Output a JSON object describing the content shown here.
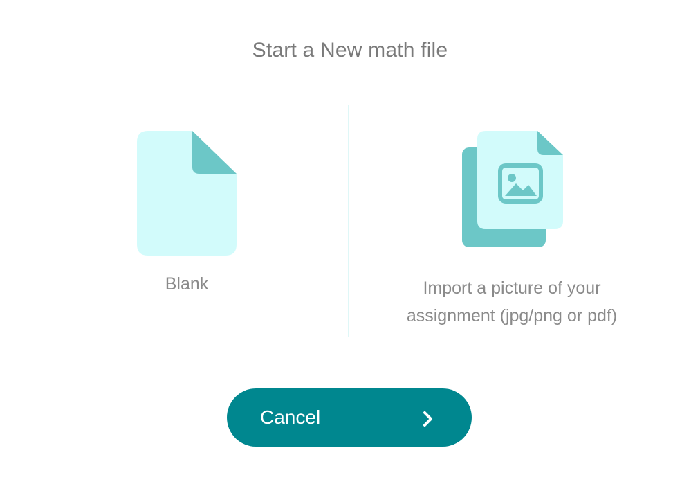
{
  "dialog": {
    "title": "Start a New math file"
  },
  "options": {
    "blank": {
      "label": "Blank",
      "icon": "blank-document-icon"
    },
    "import": {
      "label_line1": "Import a picture of your",
      "label_line2": "assignment (jpg/png or pdf)",
      "icon": "image-document-icon"
    }
  },
  "cancel": {
    "label": "Cancel",
    "icon": "chevron-right-icon"
  },
  "colors": {
    "accent": "#00878f",
    "icon_light": "#d2fbfb",
    "icon_dark": "#6cc7c7",
    "text": "#7a7a7a"
  }
}
